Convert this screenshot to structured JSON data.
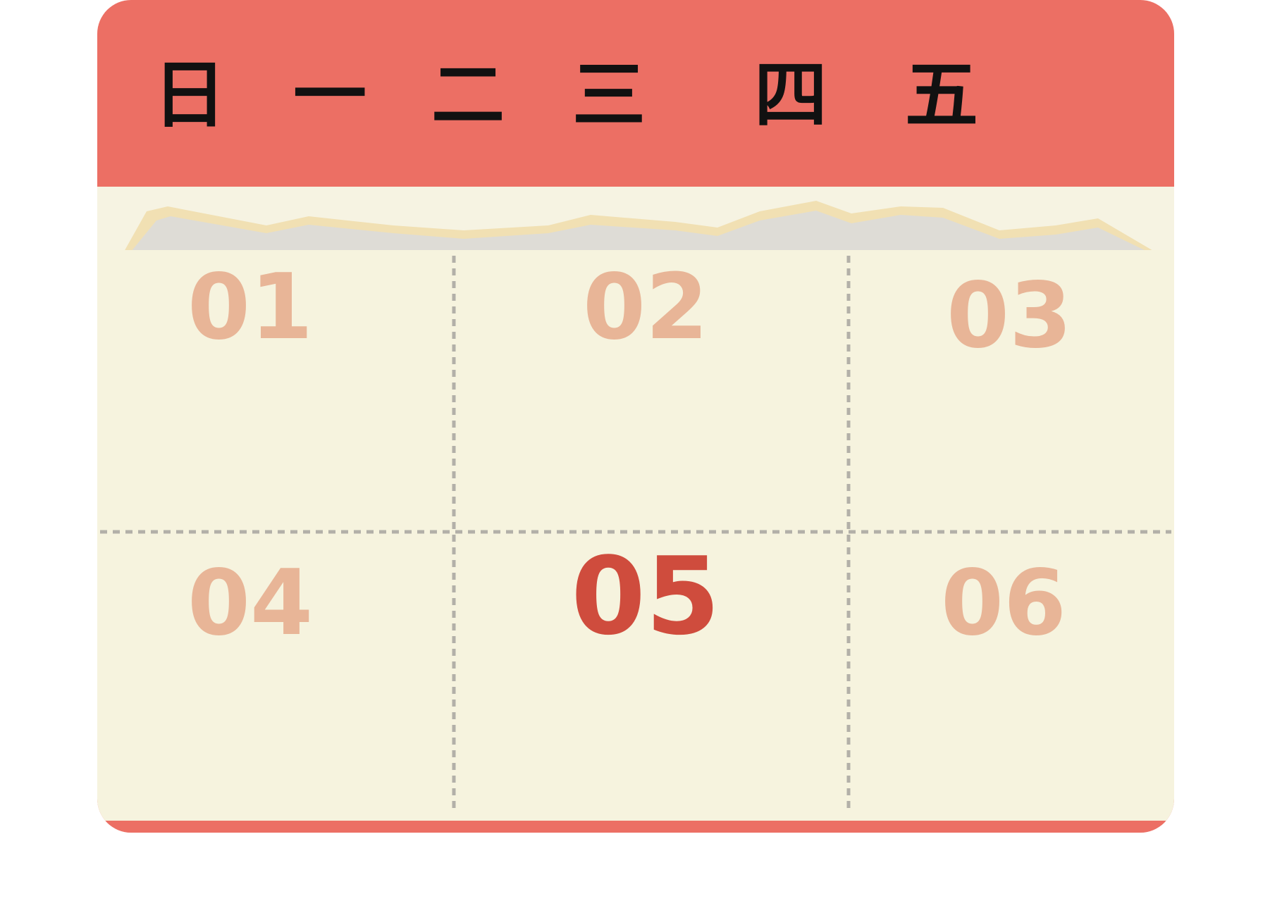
{
  "calendar": {
    "weekdays": [
      "日",
      "一",
      "二",
      "三",
      "四",
      "五"
    ],
    "days": [
      {
        "label": "01",
        "today": false
      },
      {
        "label": "02",
        "today": false
      },
      {
        "label": "03",
        "today": false
      },
      {
        "label": "04",
        "today": false
      },
      {
        "label": "05",
        "today": true
      },
      {
        "label": "06",
        "today": false
      }
    ]
  },
  "colors": {
    "header": "#ec6f64",
    "paper": "#f6f3de",
    "day_number": "#e8b597",
    "today_number": "#cf4c3d",
    "grid_line": "#b3b0a8"
  }
}
